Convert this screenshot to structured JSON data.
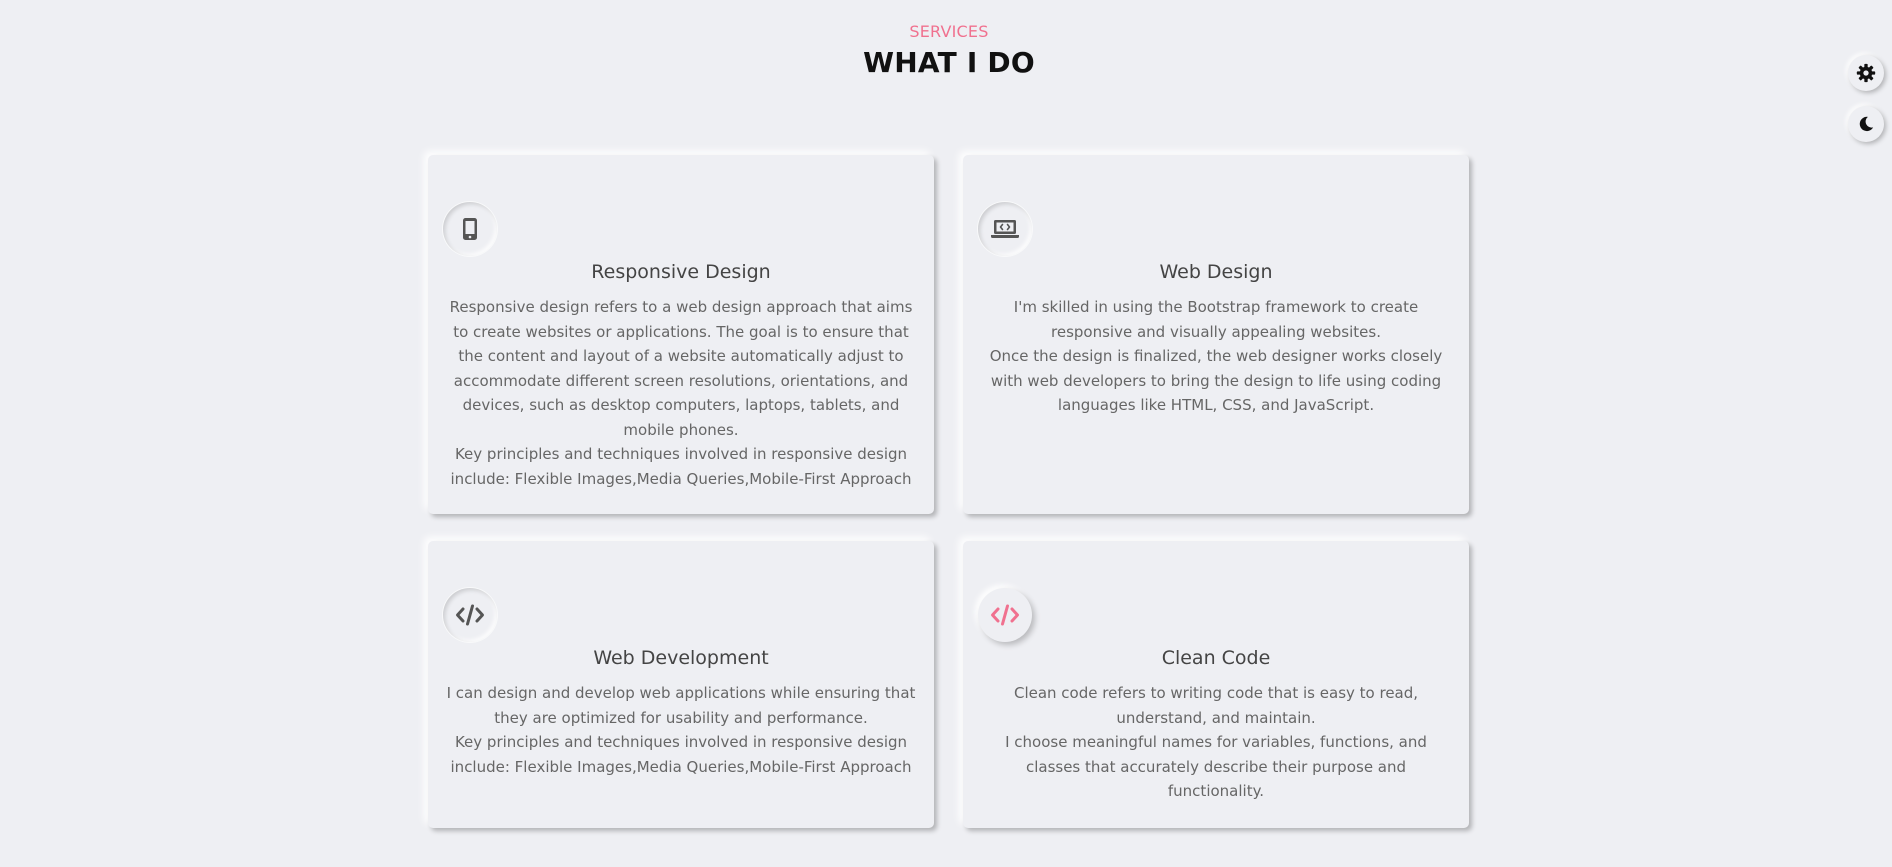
{
  "section": {
    "subtitle": "SERVICES",
    "title": "WHAT I DO"
  },
  "cards": [
    {
      "icon": "mobile-icon",
      "title": "Responsive Design",
      "paragraphs": [
        "Responsive design refers to a web design approach that aims to create websites or applications. The goal is to ensure that the content and layout of a website automatically adjust to accommodate different screen resolutions, orientations, and devices, such as desktop computers, laptops, tablets, and mobile phones.",
        "Key principles and techniques involved in responsive design include: Flexible Images,Media Queries,Mobile-First Approach"
      ]
    },
    {
      "icon": "laptop-code-icon",
      "title": "Web Design",
      "paragraphs": [
        "I'm skilled in using the Bootstrap framework to create responsive and visually appealing websites.",
        "Once the design is finalized, the web designer works closely with web developers to bring the design to life using coding languages like HTML, CSS, and JavaScript."
      ]
    },
    {
      "icon": "code-icon",
      "title": "Web Development",
      "paragraphs": [
        "I can design and develop web applications while ensuring that they are optimized for usability and performance.",
        "Key principles and techniques involved in responsive design include: Flexible Images,Media Queries,Mobile-First Approach"
      ]
    },
    {
      "icon": "code-icon",
      "title": "Clean Code",
      "paragraphs": [
        "Clean code refers to writing code that is easy to read, understand, and maintain.",
        "I choose meaningful names for variables, functions, and classes that accurately describe their purpose and functionality."
      ]
    }
  ],
  "controls": {
    "settings_icon": "gear-icon",
    "theme_icon": "moon-icon"
  },
  "colors": {
    "accent": "#f0718f",
    "background": "#eeeff3",
    "icon_gray": "#555555"
  }
}
